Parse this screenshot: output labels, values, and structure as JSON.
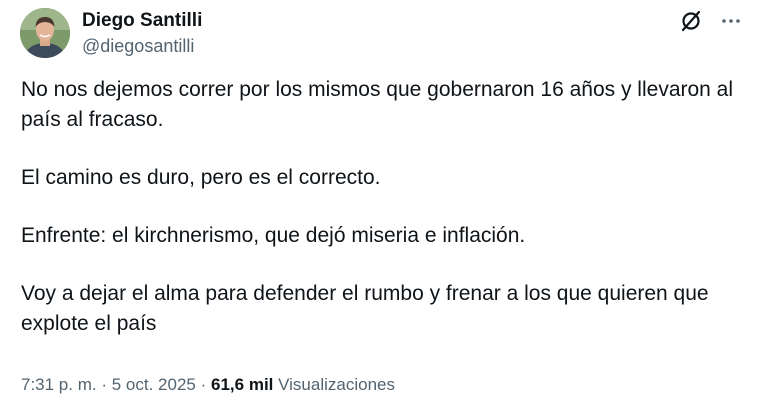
{
  "author": {
    "display_name": "Diego Santilli",
    "handle": "@diegosantilli"
  },
  "icons": {
    "grok": "grok-slash-icon",
    "more": "more-horizontal-icon"
  },
  "tweet": {
    "paragraphs": [
      "No nos dejemos correr por los mismos que gobernaron 16 años y llevaron al país al fracaso.",
      "El camino es duro, pero es el correcto.",
      "Enfrente: el kirchnerismo, que dejó miseria e inflación.",
      "Voy a dejar el alma para defender el rumbo y frenar a los que quieren que explote el país"
    ]
  },
  "meta": {
    "time": "7:31 p. m.",
    "separator": "·",
    "date": "5 oct. 2025",
    "views_count": "61,6 mil",
    "views_label": "Visualizaciones"
  },
  "colors": {
    "text_primary": "#0f1419",
    "text_secondary": "#536471",
    "background": "#ffffff"
  }
}
